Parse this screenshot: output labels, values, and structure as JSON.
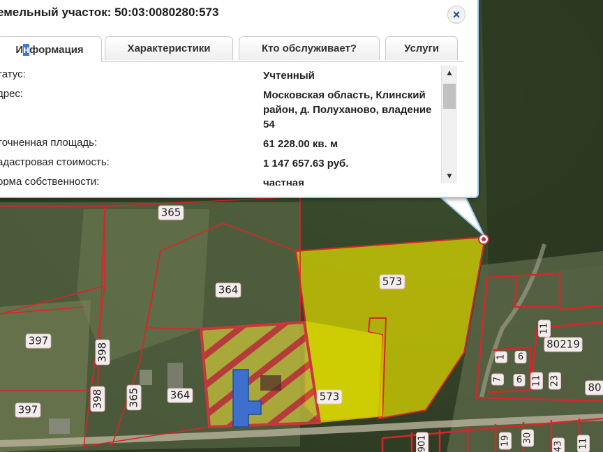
{
  "popup": {
    "title": "емельный участок: 50:03:0080280:573",
    "close_glyph": "×",
    "tabs": [
      {
        "label_pre": "И",
        "label_hl": "н",
        "label_post": "формация"
      },
      {
        "label": "Характеристики"
      },
      {
        "label": "Кто обслуживает?"
      },
      {
        "label": "Услуги"
      }
    ],
    "rows": [
      {
        "key": "татус:",
        "value": "Учтенный"
      },
      {
        "key": "дрес:",
        "value": "Московская область, Клинский район, д. Полуханово, владение 54"
      },
      {
        "key": "точненная площадь:",
        "value": "61 228.00 кв. м"
      },
      {
        "key": "адастровая стоимость:",
        "value": "1 147 657.63 руб."
      },
      {
        "key": "орма собственности:",
        "value": "частная"
      }
    ],
    "scroll_up": "▲",
    "scroll_down": "▼"
  },
  "map": {
    "labels": [
      "365",
      "364",
      "397",
      "398",
      "365",
      "364",
      "397",
      "398",
      "573",
      "573",
      "80219",
      "11",
      "6",
      "7",
      "1",
      "6",
      "11",
      "23",
      "80",
      "19",
      "30",
      "43",
      "901",
      "11"
    ],
    "colors": {
      "boundary": "#d9252a",
      "selected_fill": "#d8d500",
      "hatch": "#c8373c",
      "building": "#3d6fcd"
    }
  }
}
